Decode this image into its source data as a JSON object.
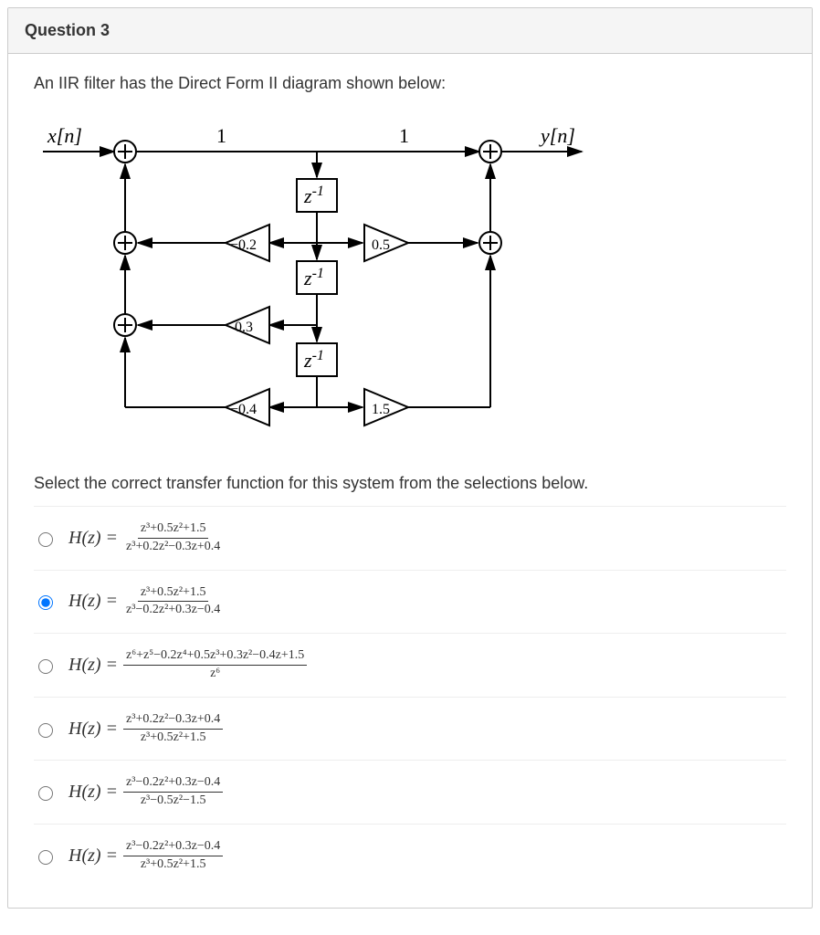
{
  "question": {
    "number": "Question 3",
    "stem": "An IIR filter has the Direct Form II diagram shown below:",
    "selectText": "Select the correct transfer function for this system from the selections below."
  },
  "diagram": {
    "inputLabel": "x[n]",
    "outputLabel": "y[n]",
    "topGainLeft": "1",
    "topGainRight": "1",
    "delay1": "z",
    "delay1exp": "-1",
    "delay2": "z",
    "delay2exp": "-1",
    "delay3": "z",
    "delay3exp": "-1",
    "a1": "0.2",
    "a2": "0.3",
    "a3": "0.4",
    "b1": "0.5",
    "b3": "1.5"
  },
  "options": {
    "labelLead": "H(z) = ",
    "items": [
      {
        "selected": false,
        "num": "z³+0.5z²+1.5",
        "den": "z³+0.2z²−0.3z+0.4"
      },
      {
        "selected": true,
        "num": "z³+0.5z²+1.5",
        "den": "z³−0.2z²+0.3z−0.4"
      },
      {
        "selected": false,
        "num": "z⁶+z⁵−0.2z⁴+0.5z³+0.3z²−0.4z+1.5",
        "den": "z⁶"
      },
      {
        "selected": false,
        "num": "z³+0.2z²−0.3z+0.4",
        "den": "z³+0.5z²+1.5"
      },
      {
        "selected": false,
        "num": "z³−0.2z²+0.3z−0.4",
        "den": "z³−0.5z²−1.5"
      },
      {
        "selected": false,
        "num": "z³−0.2z²+0.3z−0.4",
        "den": "z³+0.5z²+1.5"
      }
    ]
  },
  "chart_data": {
    "type": "diagram",
    "description": "Direct Form II IIR filter block diagram",
    "input": "x[n]",
    "output": "y[n]",
    "feedforward_top_gains": [
      1,
      1
    ],
    "delays": [
      "z^-1",
      "z^-1",
      "z^-1"
    ],
    "feedback_coefficients": {
      "a1": -0.2,
      "a2": 0.3,
      "a3": -0.4
    },
    "feedforward_coefficients": {
      "b0": 1,
      "b1": 0.5,
      "b2": 0,
      "b3": 1.5
    }
  }
}
